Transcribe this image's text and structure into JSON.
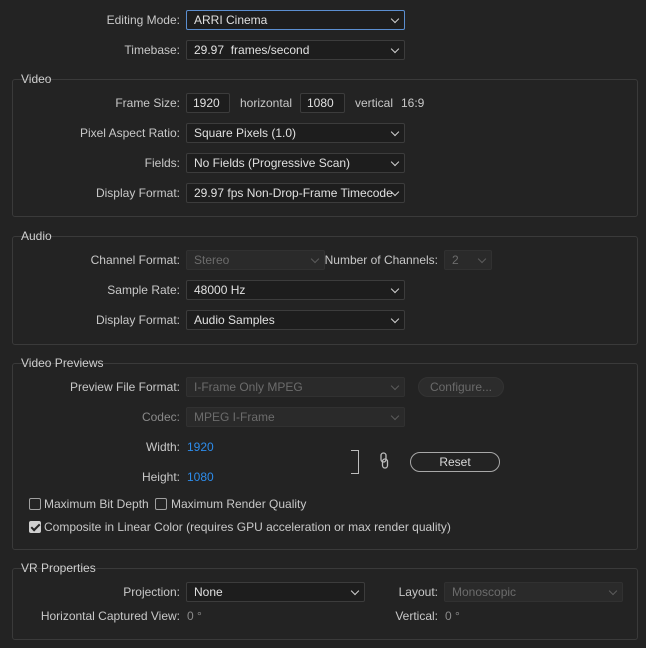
{
  "top": {
    "editing_mode_label": "Editing Mode:",
    "editing_mode_value": "ARRI Cinema",
    "timebase_label": "Timebase:",
    "timebase_value": "29.97  frames/second"
  },
  "video": {
    "title": "Video",
    "frame_size_label": "Frame Size:",
    "width": "1920",
    "horizontal_label": "horizontal",
    "height": "1080",
    "vertical_label": "vertical",
    "aspect": "16:9",
    "par_label": "Pixel Aspect Ratio:",
    "par_value": "Square Pixels (1.0)",
    "fields_label": "Fields:",
    "fields_value": "No Fields (Progressive Scan)",
    "display_format_label": "Display Format:",
    "display_format_value": "29.97 fps Non-Drop-Frame Timecode"
  },
  "audio": {
    "title": "Audio",
    "channel_format_label": "Channel Format:",
    "channel_format_value": "Stereo",
    "num_channels_label": "Number of Channels:",
    "num_channels_value": "2",
    "sample_rate_label": "Sample Rate:",
    "sample_rate_value": "48000 Hz",
    "display_format_label": "Display Format:",
    "display_format_value": "Audio Samples"
  },
  "previews": {
    "title": "Video Previews",
    "preview_format_label": "Preview File Format:",
    "preview_format_value": "I-Frame Only MPEG",
    "configure_label": "Configure...",
    "codec_label": "Codec:",
    "codec_value": "MPEG I-Frame",
    "width_label": "Width:",
    "width_value": "1920",
    "height_label": "Height:",
    "height_value": "1080",
    "reset_label": "Reset",
    "max_bit_depth_label": "Maximum Bit Depth",
    "max_bit_depth_checked": false,
    "max_render_quality_label": "Maximum Render Quality",
    "max_render_quality_checked": false,
    "linear_color_label": "Composite in Linear Color (requires GPU acceleration or max render quality)",
    "linear_color_checked": true
  },
  "vr": {
    "title": "VR Properties",
    "projection_label": "Projection:",
    "projection_value": "None",
    "layout_label": "Layout:",
    "layout_value": "Monoscopic",
    "h_view_label": "Horizontal Captured View:",
    "h_view_value": "0 °",
    "vertical_label": "Vertical:",
    "vertical_value": "0 °"
  },
  "icons": {
    "dropdown": "chevron-down-icon",
    "link": "link-icon",
    "checkbox": "checkmark-icon"
  },
  "colors": {
    "background": "#232323",
    "accent_blue": "#2d8ceb",
    "focus_border": "#5b8ed0"
  }
}
